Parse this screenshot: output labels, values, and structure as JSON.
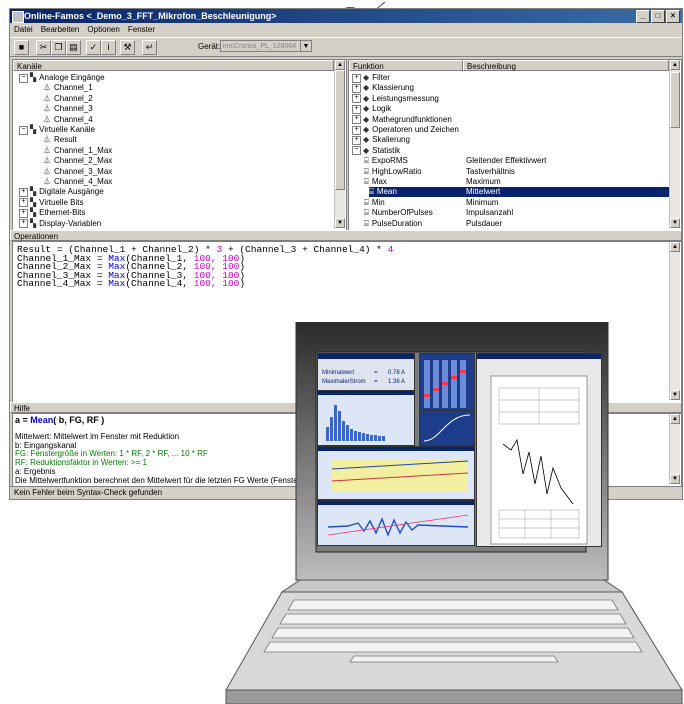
{
  "window": {
    "title": "Online-Famos <_Demo_3_FFT_Mikrofon_Beschleunigung>",
    "buttons": [
      "_",
      "□",
      "×"
    ]
  },
  "menu": [
    "Datei",
    "Bearbeiten",
    "Optionen",
    "Fenster"
  ],
  "toolbar": {
    "gerat_label": "Gerät:",
    "gerat_value": "imcCronos_PL_128064"
  },
  "kanaele": {
    "header": "Kanäle",
    "items": [
      {
        "label": "Analoge Eingänge",
        "level": 0,
        "exp": "−"
      },
      {
        "label": "Channel_1",
        "level": 2
      },
      {
        "label": "Channel_2",
        "level": 2
      },
      {
        "label": "Channel_3",
        "level": 2
      },
      {
        "label": "Channel_4",
        "level": 2
      },
      {
        "label": "Virtuelle Kanäle",
        "level": 0,
        "exp": "−"
      },
      {
        "label": "Result",
        "level": 2
      },
      {
        "label": "Channel_1_Max",
        "level": 2
      },
      {
        "label": "Channel_2_Max",
        "level": 2
      },
      {
        "label": "Channel_3_Max",
        "level": 2
      },
      {
        "label": "Channel_4_Max",
        "level": 2
      },
      {
        "label": "Digitale Ausgänge",
        "level": 0,
        "exp": "+"
      },
      {
        "label": "Virtuelle Bits",
        "level": 0,
        "exp": "+"
      },
      {
        "label": "Ethernet-Bits",
        "level": 0,
        "exp": "+"
      },
      {
        "label": "Display-Variablen",
        "level": 0,
        "exp": "+"
      }
    ]
  },
  "funktion": {
    "header_funktion": "Funktion",
    "header_beschreibung": "Beschreibung",
    "items": [
      {
        "name": "Filter",
        "desc": "",
        "level": 0,
        "exp": "+"
      },
      {
        "name": "Klassierung",
        "desc": "",
        "level": 0,
        "exp": "+"
      },
      {
        "name": "Leistungsmessung",
        "desc": "",
        "level": 0,
        "exp": "+"
      },
      {
        "name": "Logik",
        "desc": "",
        "level": 0,
        "exp": "+"
      },
      {
        "name": "Mathegrundfunktionen",
        "desc": "",
        "level": 0,
        "exp": "+"
      },
      {
        "name": "Operatoren und Zeichen",
        "desc": "",
        "level": 0,
        "exp": "+"
      },
      {
        "name": "Skalierung",
        "desc": "",
        "level": 0,
        "exp": "+"
      },
      {
        "name": "Statistik",
        "desc": "",
        "level": 0,
        "exp": "−"
      },
      {
        "name": "ExpoRMS",
        "desc": "Gleitender Effektivwert",
        "level": 1
      },
      {
        "name": "HighLowRatio",
        "desc": "Tastverhältnis",
        "level": 1
      },
      {
        "name": "Max",
        "desc": "Maximum",
        "level": 1
      },
      {
        "name": "Mean",
        "desc": "Mittelwert",
        "level": 1,
        "selected": true
      },
      {
        "name": "Min",
        "desc": "Minimum",
        "level": 1
      },
      {
        "name": "NumberOfPulses",
        "desc": "Impulsanzahl",
        "level": 1
      },
      {
        "name": "PulseDuration",
        "desc": "Pulsdauer",
        "level": 1
      }
    ]
  },
  "operationen": {
    "header": "Operationen",
    "line1": {
      "a": "Result = (Channel_1 + Channel_2) * ",
      "n1": "3",
      "b": " + (Channel_3 + Channel_4) * ",
      "n2": "4"
    },
    "lines": [
      {
        "a": "Channel_1_Max = ",
        "fn": "Max",
        "b": "(Channel_1, ",
        "n": "100, 100",
        "c": ")"
      },
      {
        "a": "Channel_2_Max = ",
        "fn": "Max",
        "b": "(Channel_2, ",
        "n": "100, 100",
        "c": ")"
      },
      {
        "a": "Channel_3_Max = ",
        "fn": "Max",
        "b": "(Channel_3, ",
        "n": "100, 100",
        "c": ")"
      },
      {
        "a": "Channel_4_Max = ",
        "fn": "Max",
        "b": "(Channel_4, ",
        "n": "100, 100",
        "c": ")"
      }
    ]
  },
  "hilfe": {
    "header": "Hilfe",
    "sig_a": "a = ",
    "sig_fn": "Mean",
    "sig_b": "( b, FG, RF )",
    "lines": [
      {
        "t": "Mittelwert: Mittelwert im Fenster mit Reduktion",
        "c": "#000000"
      },
      {
        "t": "b: Eingangskanal",
        "c": "#000000"
      },
      {
        "t": "FG: Fenstergröße in Werten: 1 * RF, 2 * RF, ... 10 * RF",
        "c": "#008000"
      },
      {
        "t": "RF: Reduktionsfaktor in Werten: >= 1",
        "c": "#008000"
      },
      {
        "t": "a: Ergebnis",
        "c": "#000000"
      },
      {
        "t": "Die Mittelwertfunktion berechnet den Mittelwert für die letzten FG Werte (Fenster) und erze",
        "c": "#000000"
      }
    ]
  },
  "status": "Kein Fehler beim Syntax-Check gefunden",
  "screen": {
    "min_label": "Minimalwert",
    "min_eq": "=",
    "min_value": "0.78 A",
    "max_label": "MaximalerStrom",
    "max_eq": "=",
    "max_value": "1.38 A"
  },
  "colors": {
    "selection": "#0a246a",
    "function_blue": "#0000cc",
    "number_magenta": "#cc00cc",
    "help_green": "#008000"
  }
}
